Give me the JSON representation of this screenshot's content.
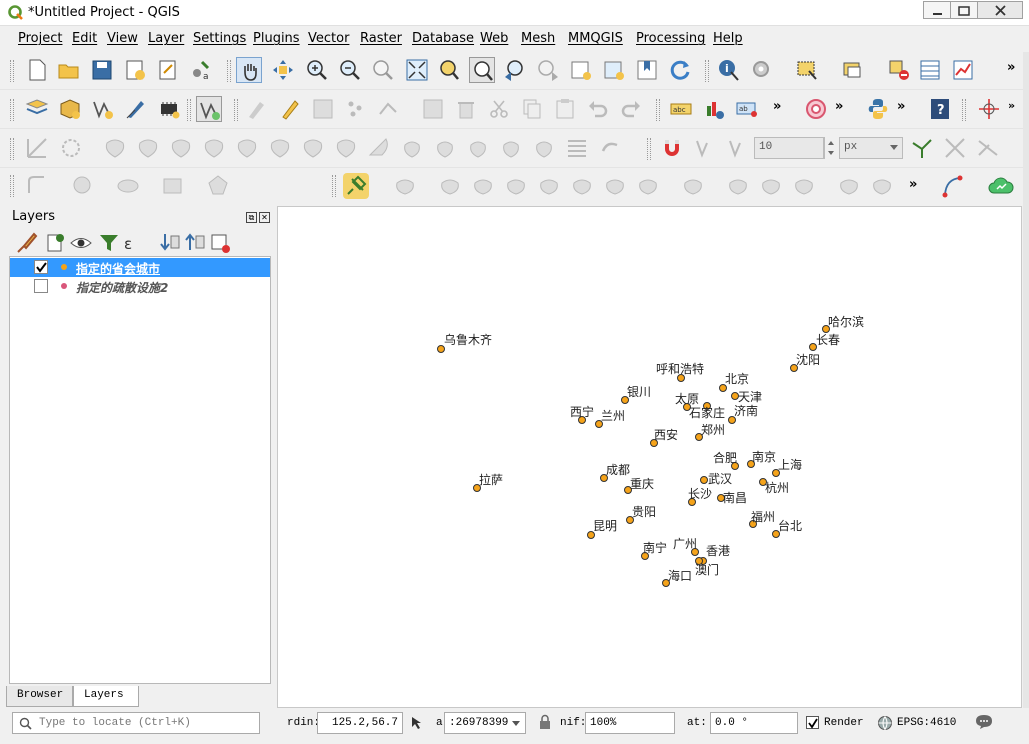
{
  "window": {
    "title": "*Untitled Project - QGIS"
  },
  "menu": [
    "Project",
    "Edit",
    "View",
    "Layer",
    "Settings",
    "Plugins",
    "Vector",
    "Raster",
    "Database",
    "Web",
    "Mesh",
    "MMQGIS",
    "Processing",
    "Help"
  ],
  "snapping": {
    "tolerance": "10",
    "units": "px"
  },
  "more_glyph": "»",
  "layers_panel": {
    "title": "Layers",
    "layers": [
      {
        "name": "指定的省会城市",
        "checked": true,
        "color": "#f5a31a"
      },
      {
        "name": "指定的疏散设施2",
        "checked": false,
        "color": "#d9567a"
      }
    ],
    "tabs": [
      "Browser",
      "Layers"
    ]
  },
  "cities": [
    {
      "name": "乌鲁木齐"
    },
    {
      "name": "哈尔滨"
    },
    {
      "name": "长春"
    },
    {
      "name": "沈阳"
    },
    {
      "name": "呼和浩特"
    },
    {
      "name": "北京"
    },
    {
      "name": "天津"
    },
    {
      "name": "银川"
    },
    {
      "name": "太原"
    },
    {
      "name": "石家庄"
    },
    {
      "name": "济南"
    },
    {
      "name": "西宁"
    },
    {
      "name": "兰州"
    },
    {
      "name": "郑州"
    },
    {
      "name": "西安"
    },
    {
      "name": "合肥"
    },
    {
      "name": "南京"
    },
    {
      "name": "上海"
    },
    {
      "name": "成都"
    },
    {
      "name": "武汉"
    },
    {
      "name": "杭州"
    },
    {
      "name": "拉萨"
    },
    {
      "name": "重庆"
    },
    {
      "name": "长沙"
    },
    {
      "name": "南昌"
    },
    {
      "name": "贵阳"
    },
    {
      "name": "福州"
    },
    {
      "name": "昆明"
    },
    {
      "name": "台北"
    },
    {
      "name": "广州"
    },
    {
      "name": "南宁"
    },
    {
      "name": "香港"
    },
    {
      "name": "澳门"
    },
    {
      "name": "海口"
    }
  ],
  "statusbar": {
    "locator_placeholder": "Type to locate (Ctrl+K)",
    "coord_label": "rdin:",
    "coord_value": "125.2,56.7",
    "scale_label": "a",
    "scale_value": ":26978399",
    "magnifier_label": "nif:",
    "magnifier_value": "100%",
    "rotation_label": "at:",
    "rotation_value": "0.0 °",
    "render_label": "Render",
    "render_checked": true,
    "crs": "EPSG:4610"
  }
}
